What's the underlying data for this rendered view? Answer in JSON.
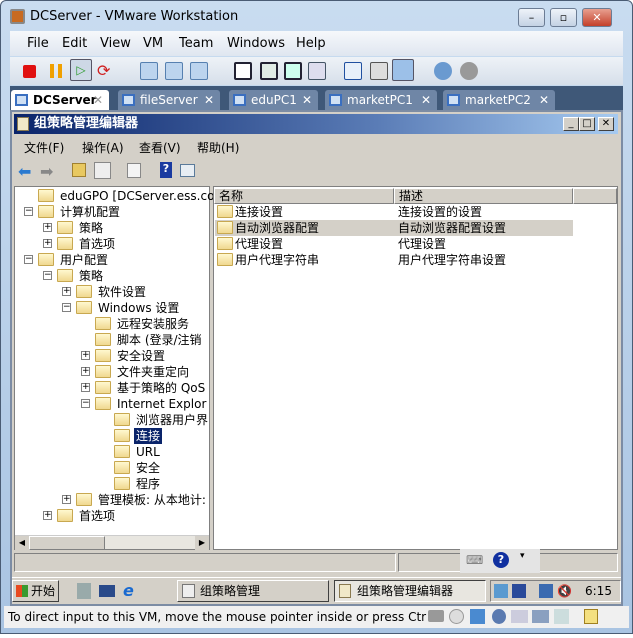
{
  "window": {
    "title": "DCServer - VMware Workstation",
    "minimize": "–",
    "maximize": "▫",
    "close": "✕"
  },
  "menu": [
    "File",
    "Edit",
    "View",
    "VM",
    "Team",
    "Windows",
    "Help"
  ],
  "toolbar_icons": [
    "stop-icon",
    "pause-icon",
    "play-icon",
    "reset-icon",
    "snapshot-icon",
    "revert-snapshot-icon",
    "snapshot-manager-icon",
    "sidebar-icon",
    "quick-switch-icon",
    "fullscreen-icon",
    "unity-icon",
    "vm-settings-icon",
    "console-icon",
    "summary-icon",
    "record-icon",
    "replay-icon"
  ],
  "tabs": [
    {
      "label": "DCServer",
      "active": true
    },
    {
      "label": "fileServer"
    },
    {
      "label": "eduPC1"
    },
    {
      "label": "marketPC1"
    },
    {
      "label": "marketPC2"
    }
  ],
  "guest": {
    "title": "组策略管理编辑器",
    "menu": [
      "文件(F)",
      "操作(A)",
      "查看(V)",
      "帮助(H)"
    ],
    "tree": [
      {
        "label": "eduGPO [DCServer.ess.com] 策",
        "level": 0,
        "exp": ""
      },
      {
        "label": "计算机配置",
        "level": 0,
        "exp": "-"
      },
      {
        "label": "策略",
        "level": 1,
        "exp": "+"
      },
      {
        "label": "首选项",
        "level": 1,
        "exp": "+"
      },
      {
        "label": "用户配置",
        "level": 0,
        "exp": "-"
      },
      {
        "label": "策略",
        "level": 1,
        "exp": "-"
      },
      {
        "label": "软件设置",
        "level": 2,
        "exp": "+"
      },
      {
        "label": "Windows 设置",
        "level": 2,
        "exp": "-"
      },
      {
        "label": "远程安装服务",
        "level": 3,
        "exp": ""
      },
      {
        "label": "脚本 (登录/注销",
        "level": 3,
        "exp": ""
      },
      {
        "label": "安全设置",
        "level": 3,
        "exp": "+"
      },
      {
        "label": "文件夹重定向",
        "level": 3,
        "exp": "+"
      },
      {
        "label": "基于策略的 QoS",
        "level": 3,
        "exp": "+"
      },
      {
        "label": "Internet Explor",
        "level": 3,
        "exp": "-"
      },
      {
        "label": "浏览器用户界",
        "level": 4,
        "exp": ""
      },
      {
        "label": "连接",
        "level": 4,
        "exp": "",
        "selected": true
      },
      {
        "label": "URL",
        "level": 4,
        "exp": ""
      },
      {
        "label": "安全",
        "level": 4,
        "exp": ""
      },
      {
        "label": "程序",
        "level": 4,
        "exp": ""
      },
      {
        "label": "管理模板: 从本地计:",
        "level": 2,
        "exp": "+"
      },
      {
        "label": "首选项",
        "level": 1,
        "exp": "+"
      }
    ],
    "columns": [
      "名称",
      "描述"
    ],
    "rows": [
      {
        "name": "连接设置",
        "desc": "连接设置的设置"
      },
      {
        "name": "自动浏览器配置",
        "desc": "自动浏览器配置设置",
        "highlight": true
      },
      {
        "name": "代理设置",
        "desc": "代理设置"
      },
      {
        "name": "用户代理字符串",
        "desc": "用户代理字符串设置"
      }
    ],
    "taskbar": {
      "start": "开始",
      "items": [
        "组策略管理",
        "组策略管理编辑器"
      ],
      "clock": "6:15"
    }
  },
  "status": "To direct input to this VM, move the mouse pointer inside or press Ctr"
}
